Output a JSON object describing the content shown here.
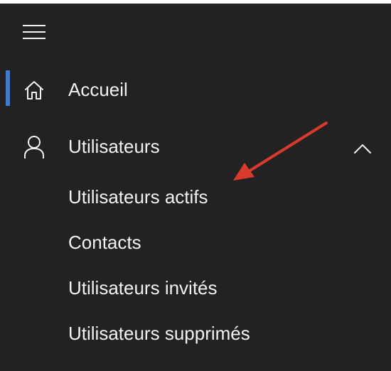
{
  "nav": {
    "menu_icon": "hamburger-menu-icon",
    "items": [
      {
        "label": "Accueil",
        "icon": "home-icon",
        "active": true
      },
      {
        "label": "Utilisateurs",
        "icon": "person-icon",
        "expanded": true,
        "expand_icon": "chevron-up-icon",
        "children": [
          {
            "label": "Utilisateurs actifs"
          },
          {
            "label": "Contacts"
          },
          {
            "label": "Utilisateurs invités"
          },
          {
            "label": "Utilisateurs supprimés"
          }
        ]
      }
    ]
  },
  "annotation": {
    "type": "arrow",
    "points_to": "Utilisateurs actifs",
    "color": "#d93a2b"
  },
  "colors": {
    "panel_bg": "#222222",
    "text": "#f2f2f2",
    "active_indicator": "#3a7bd5",
    "arrow": "#d93a2b"
  }
}
